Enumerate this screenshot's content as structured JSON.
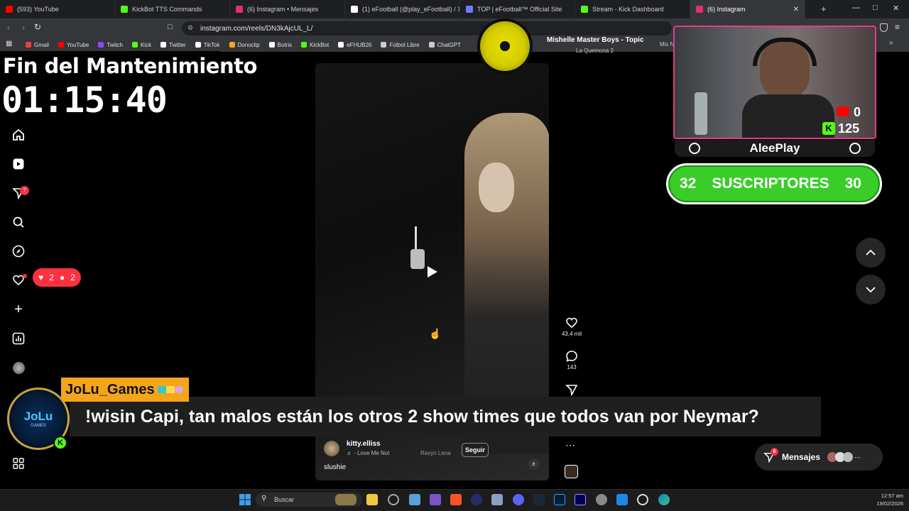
{
  "browser": {
    "tabs": [
      {
        "label": "(593) YouTube",
        "color": "#ff0000"
      },
      {
        "label": "KickBot TTS Commands",
        "color": "#53fc18"
      },
      {
        "label": "(6) Instagram • Mensajes",
        "color": "#e1306c"
      },
      {
        "label": "(1) eFootball (@play_eFootball) / X",
        "color": "#ffffff"
      },
      {
        "label": "TOP | eFootball™ Official Site",
        "color": "#6f7cff"
      },
      {
        "label": "Stream - Kick Dashboard",
        "color": "#53fc18"
      },
      {
        "label": "(6) Instagram",
        "color": "#e1306c",
        "active": true
      }
    ],
    "url": "instagram.com/reels/DN3kAjcUL_L/",
    "bookmarks": [
      {
        "label": "Gmail",
        "color": "#ea4335"
      },
      {
        "label": "YouTube",
        "color": "#ff0000"
      },
      {
        "label": "Twitch",
        "color": "#9146ff"
      },
      {
        "label": "Kick",
        "color": "#53fc18"
      },
      {
        "label": "Twitter",
        "color": "#ffffff"
      },
      {
        "label": "TikTok",
        "color": "#ffffff"
      },
      {
        "label": "Donoclip",
        "color": "#f5a623"
      },
      {
        "label": "Botrix",
        "color": "#ffffff"
      },
      {
        "label": "KickBot",
        "color": "#53fc18"
      },
      {
        "label": "eFHUB26",
        "color": "#ffffff"
      },
      {
        "label": "Fútbol Libre",
        "color": "#cccccc"
      },
      {
        "label": "ChatGPT",
        "color": "#cccccc"
      }
    ],
    "bookmark_overflow": "Mix N"
  },
  "overlay": {
    "timer_title": "Fin del Mantenimiento",
    "timer_value": "01:15:40",
    "music_title": "Mishelle Master Boys - Topic",
    "music_subtitle": "La Quemona 2",
    "streamer_name": "AleePlay",
    "youtube_count": "0",
    "kick_count": "125",
    "subs_left": "32",
    "subs_label": "SUSCRIPTORES",
    "subs_right": "30",
    "chat_username": "JoLu_Games",
    "chat_message": "!wisin Capi, tan malos están los otros 2 show times que todos van por Neymar?",
    "chat_avatar_text": "JoLu",
    "chat_avatar_sub": "GAMES"
  },
  "instagram": {
    "notif_badge": "7",
    "activity_likes": "2",
    "activity_follows": "2",
    "like_count": "43,4 mil",
    "comment_count": "143",
    "author": "kitty.elliss",
    "follow_label": "Seguir",
    "audio_label": "♬ - Love Me Not",
    "audio_artist": "Ravyn Lena",
    "caption": "slushie",
    "messages_label": "Mensajes",
    "messages_badge": "6"
  },
  "taskbar": {
    "search_placeholder": "Buscar",
    "time": "12:57 am",
    "date": "19/02/2026"
  },
  "colors": {
    "accent_green": "#3acd2a",
    "instagram_red": "#ff3040",
    "chat_yellow": "#f5a51c",
    "cam_border": "#e23d8a"
  }
}
